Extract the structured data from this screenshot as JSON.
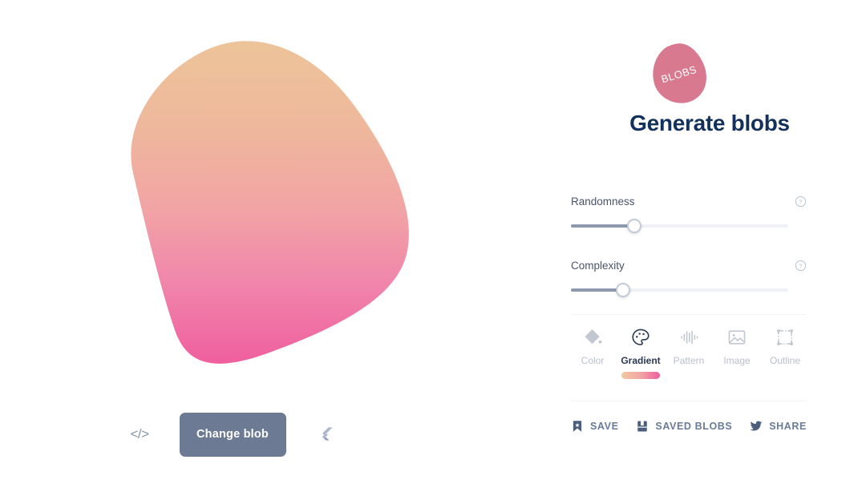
{
  "app": {
    "title": "Generate blobs",
    "logo_text": "BLOBS",
    "background": "#ffffff"
  },
  "colors": {
    "blob_gradient_start": "#edc49a",
    "blob_gradient_end": "#ef5f9e",
    "title_color": "#13315c",
    "logo_fill": "#d9798f",
    "button_bg": "#6c7a93",
    "slider_fill": "#8d99ae",
    "slider_track": "#eef1f5",
    "action_text": "#6a7b96"
  },
  "stage": {
    "blob_name": "generated-blob",
    "code_button": {
      "icon": "code-icon",
      "label": "</>"
    },
    "change_button": {
      "label": "Change blob"
    },
    "flutter_button": {
      "icon": "flutter-icon",
      "label": "Flutter"
    }
  },
  "controls": {
    "sliders": [
      {
        "name": "randomness",
        "label": "Randomness",
        "value": 29,
        "min": 0,
        "max": 100,
        "help_icon": "help-circle-icon"
      },
      {
        "name": "complexity",
        "label": "Complexity",
        "value": 24,
        "min": 0,
        "max": 100,
        "help_icon": "help-circle-icon"
      }
    ]
  },
  "fill_tabs": {
    "selected": "Gradient",
    "items": [
      {
        "label": "Color",
        "icon": "paint-bucket-icon",
        "active": false
      },
      {
        "label": "Gradient",
        "icon": "palette-icon",
        "active": true
      },
      {
        "label": "Pattern",
        "icon": "waveform-icon",
        "active": false
      },
      {
        "label": "Image",
        "icon": "image-icon",
        "active": false
      },
      {
        "label": "Outline",
        "icon": "outline-box-icon",
        "active": false
      }
    ]
  },
  "actions": [
    {
      "label": "SAVE",
      "icon": "bookmark-star-icon"
    },
    {
      "label": "SAVED BLOBS",
      "icon": "book-icon"
    },
    {
      "label": "SHARE",
      "icon": "twitter-icon"
    }
  ]
}
